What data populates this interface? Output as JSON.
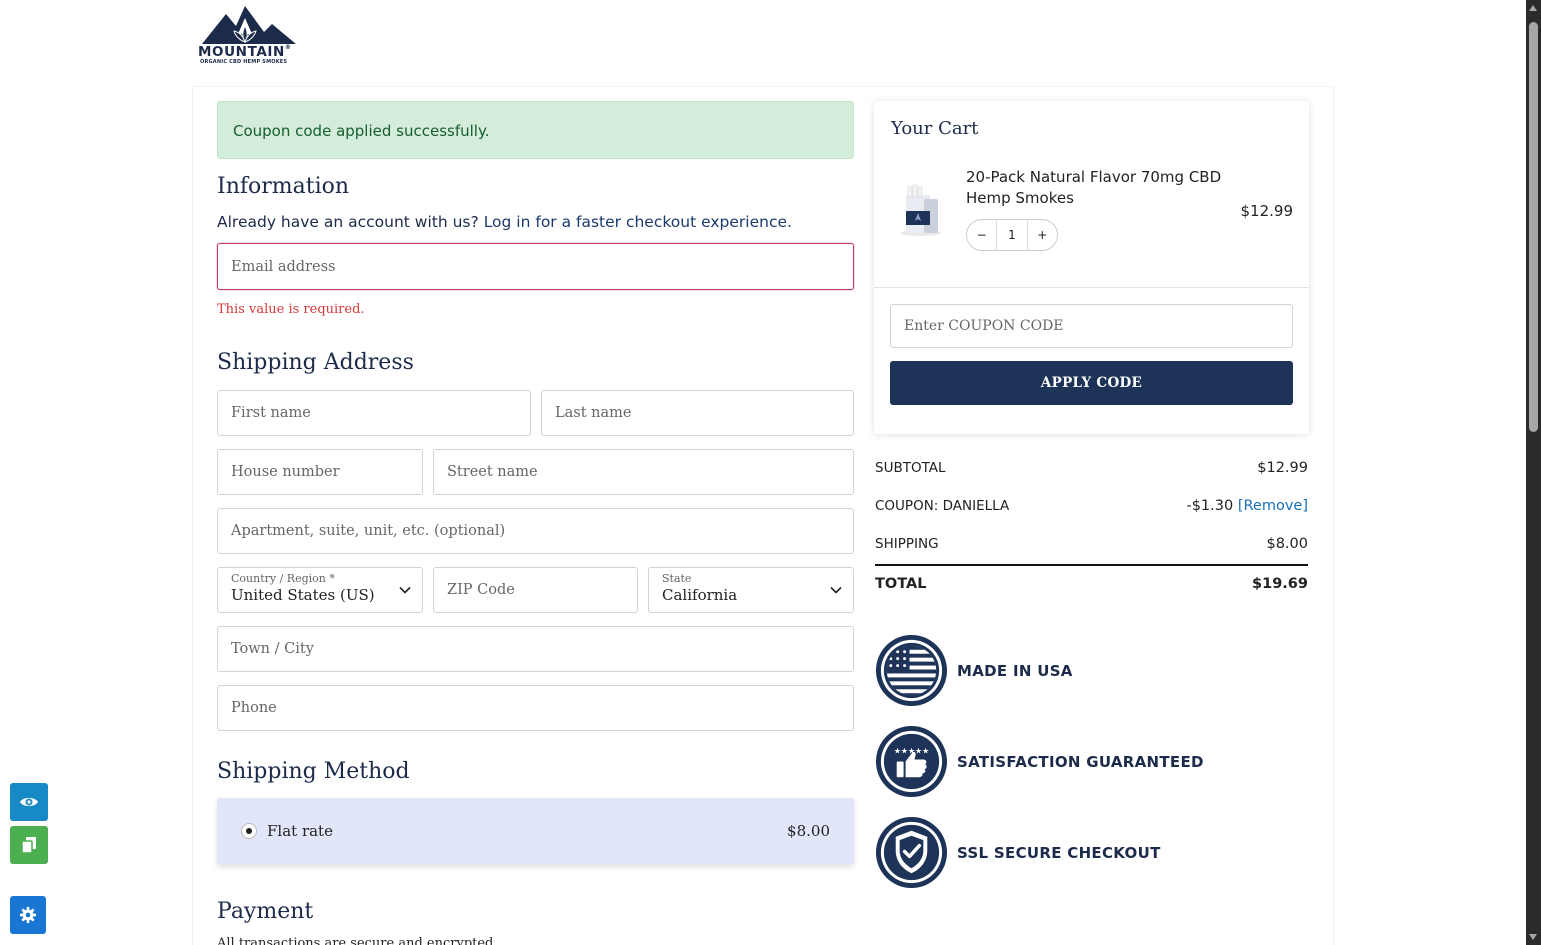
{
  "brand": {
    "name": "MOUNTAIN",
    "registered": "®",
    "tagline": "ORGANIC CBD HEMP SMOKES"
  },
  "alert": {
    "message": "Coupon code applied successfully."
  },
  "information": {
    "heading": "Information",
    "account_prompt": "Already have an account with us?",
    "login_link": "Log in for a faster checkout experience.",
    "email_placeholder": "Email address",
    "email_error": "This value is required."
  },
  "shipping_address": {
    "heading": "Shipping Address",
    "first_name_placeholder": "First name",
    "last_name_placeholder": "Last name",
    "house_number_placeholder": "House number",
    "street_name_placeholder": "Street name",
    "apartment_placeholder": "Apartment, suite, unit, etc. (optional)",
    "country_label": "Country / Region *",
    "country_value": "United States (US)",
    "zip_placeholder": "ZIP Code",
    "state_label": "State",
    "state_value": "California",
    "city_placeholder": "Town / City",
    "phone_placeholder": "Phone"
  },
  "shipping_method": {
    "heading": "Shipping Method",
    "option_label": "Flat rate",
    "option_price": "$8.00"
  },
  "payment": {
    "heading": "Payment",
    "subtitle": "All transactions are secure and encrypted."
  },
  "cart": {
    "title": "Your Cart",
    "item": {
      "name": "20-Pack Natural Flavor 70mg CBD Hemp Smokes",
      "price": "$12.99",
      "quantity": "1",
      "decrement": "−",
      "increment": "+"
    },
    "coupon_placeholder": "Enter COUPON CODE",
    "apply_label": "APPLY CODE"
  },
  "totals": {
    "subtotal_label": "SUBTOTAL",
    "subtotal_value": "$12.99",
    "coupon_label": "COUPON: DANIELLA",
    "coupon_value": "-$1.30",
    "coupon_remove": "[Remove]",
    "shipping_label": "SHIPPING",
    "shipping_value": "$8.00",
    "total_label": "TOTAL",
    "total_value": "$19.69"
  },
  "badges": [
    {
      "label": "MADE IN USA",
      "icon": "us-flag-icon"
    },
    {
      "label": "SATISFACTION GUARANTEED",
      "icon": "thumbs-up-icon"
    },
    {
      "label": "SSL SECURE CHECKOUT",
      "icon": "shield-check-icon"
    }
  ],
  "colors": {
    "brand_navy": "#1e3358",
    "success_bg": "#d4ecda",
    "error": "#d9383a",
    "shipping_bg": "#e1e6fa",
    "link": "#1a6fb5"
  }
}
